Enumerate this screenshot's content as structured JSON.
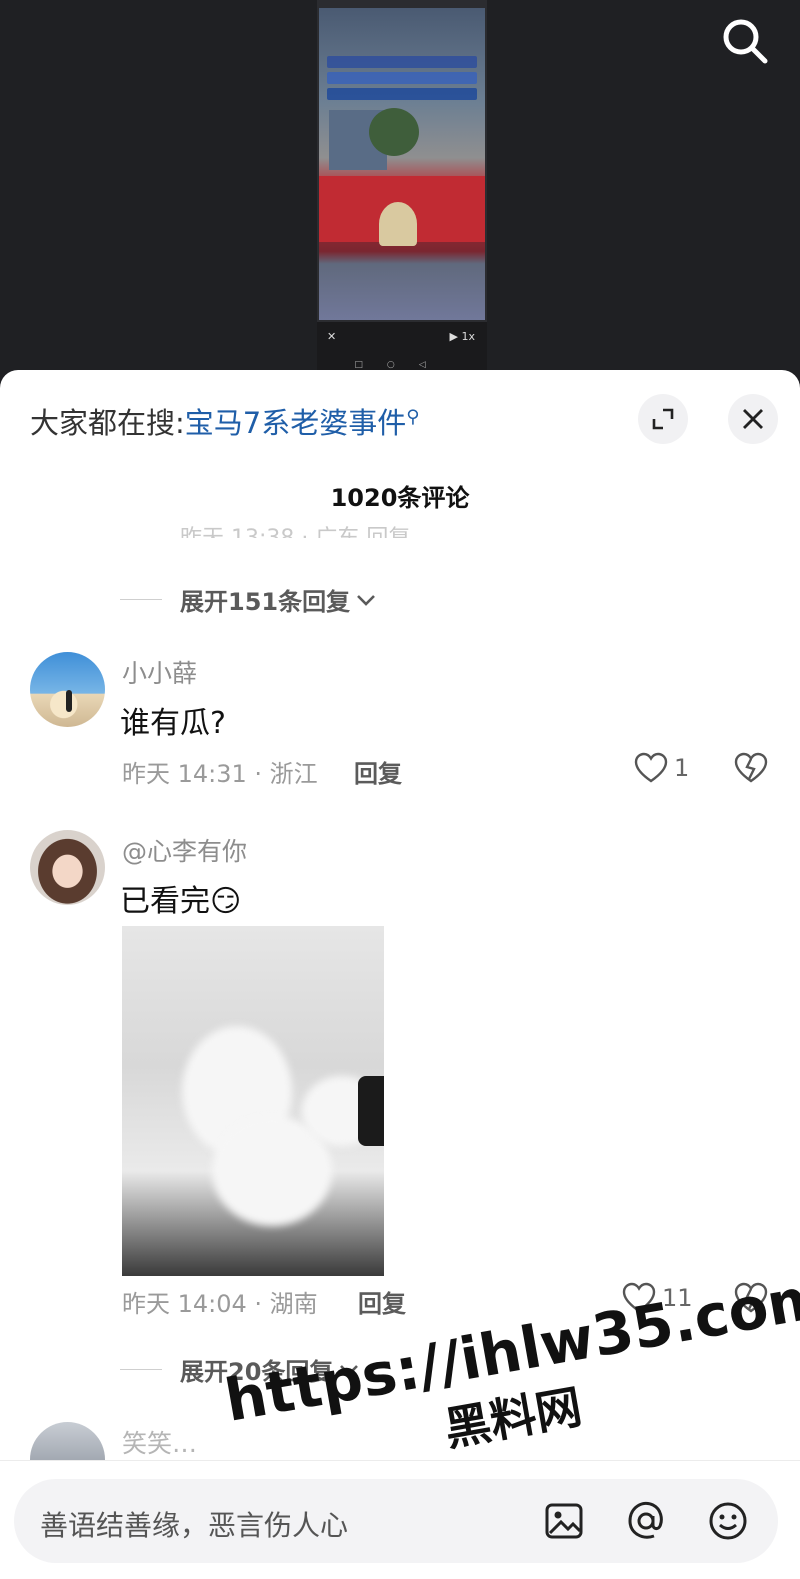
{
  "video": {
    "caption_lines": [
      "男子在路上开车拉横幅",
      "丈夫在大街上开车拉横幅",
      "公开喊话老婆与他人出轨"
    ],
    "controls": {
      "close": "✕",
      "speed": "1x"
    }
  },
  "sheet": {
    "search_prefix": "大家都在搜:",
    "search_term": "宝马7系老婆事件",
    "comment_count": "1020条评论",
    "cutoff_text": "昨天 13:38 · 广东     回复"
  },
  "comments": [
    {
      "expand": "展开151条回复",
      "name": "小小薛",
      "text": "谁有瓜?",
      "meta": "昨天 14:31 · 浙江",
      "reply": "回复",
      "likes": "1"
    },
    {
      "name": "@心李有你",
      "text": "已看完😏",
      "meta": "昨天 14:04 · 湖南",
      "reply": "回复",
      "likes": "11",
      "expand": "展开20条回复"
    },
    {
      "name": "笑笑…"
    }
  ],
  "input": {
    "placeholder": "善语结善缘，恶言伤人心"
  },
  "watermark": {
    "url": "https://ihlw35.com",
    "name": "黑料网"
  },
  "colors": {
    "accent_link": "#1f5ea8",
    "sheet_bg": "#ffffff",
    "video_bg": "#1f2023"
  }
}
